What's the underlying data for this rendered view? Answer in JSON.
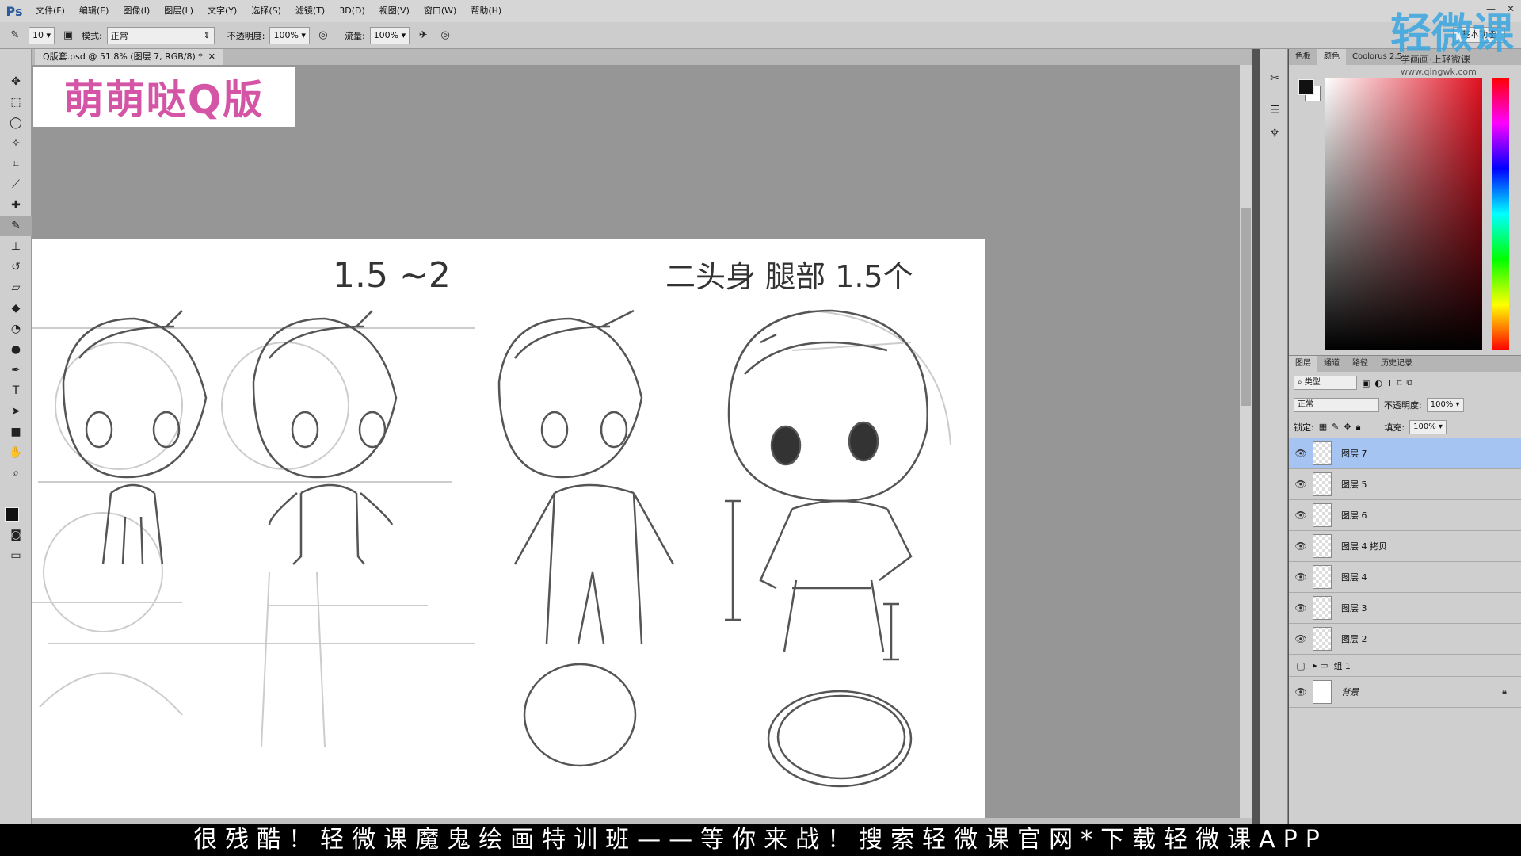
{
  "app": {
    "logo": "Ps"
  },
  "menu": [
    "文件(F)",
    "编辑(E)",
    "图像(I)",
    "图层(L)",
    "文字(Y)",
    "选择(S)",
    "滤镜(T)",
    "3D(D)",
    "视图(V)",
    "窗口(W)",
    "帮助(H)"
  ],
  "options": {
    "brush_size": "10",
    "mode_label": "模式:",
    "mode_value": "正常",
    "opacity_label": "不透明度:",
    "opacity_value": "100%",
    "flow_label": "流量:",
    "flow_value": "100%",
    "workspace": "基本功能"
  },
  "document": {
    "tab_title": "Q版套.psd @ 51.8% (图层 7, RGB/8) *"
  },
  "logo_card": {
    "text": "萌萌哒Q版"
  },
  "sketch": {
    "label_1": "1.5 ~2",
    "label_2": "二头身 腿部 1.5个"
  },
  "color_panel": {
    "tabs": [
      "色板",
      "颜色",
      "Coolorus 2.5"
    ]
  },
  "layers_panel": {
    "tabs": [
      "图层",
      "通道",
      "路径",
      "历史记录"
    ],
    "filter": "类型",
    "blend": "正常",
    "opacity_label": "不透明度:",
    "opacity_value": "100%",
    "lock_label": "锁定:",
    "fill_label": "填充:",
    "fill_value": "100%",
    "layers": [
      {
        "name": "图层 7",
        "selected": true,
        "visible": true
      },
      {
        "name": "图层 5",
        "visible": true
      },
      {
        "name": "图层 6",
        "visible": true
      },
      {
        "name": "图层 4 拷贝",
        "visible": true
      },
      {
        "name": "图层 4",
        "visible": true
      },
      {
        "name": "图层 3",
        "visible": true
      },
      {
        "name": "图层 2",
        "visible": true
      }
    ],
    "group": "组 1",
    "background": "背景"
  },
  "watermark": {
    "main": "轻微课",
    "sub": "学画画·上轻微课",
    "url": "www.qingwk.com"
  },
  "subtitle": "很残酷！轻微课魔鬼绘画特训班——等你来战！搜索轻微课官网*下载轻微课APP",
  "colors": {
    "logo_pink": "#d454a5",
    "watermark_blue": "#39a6e0",
    "selection": "#a6c4f2"
  }
}
